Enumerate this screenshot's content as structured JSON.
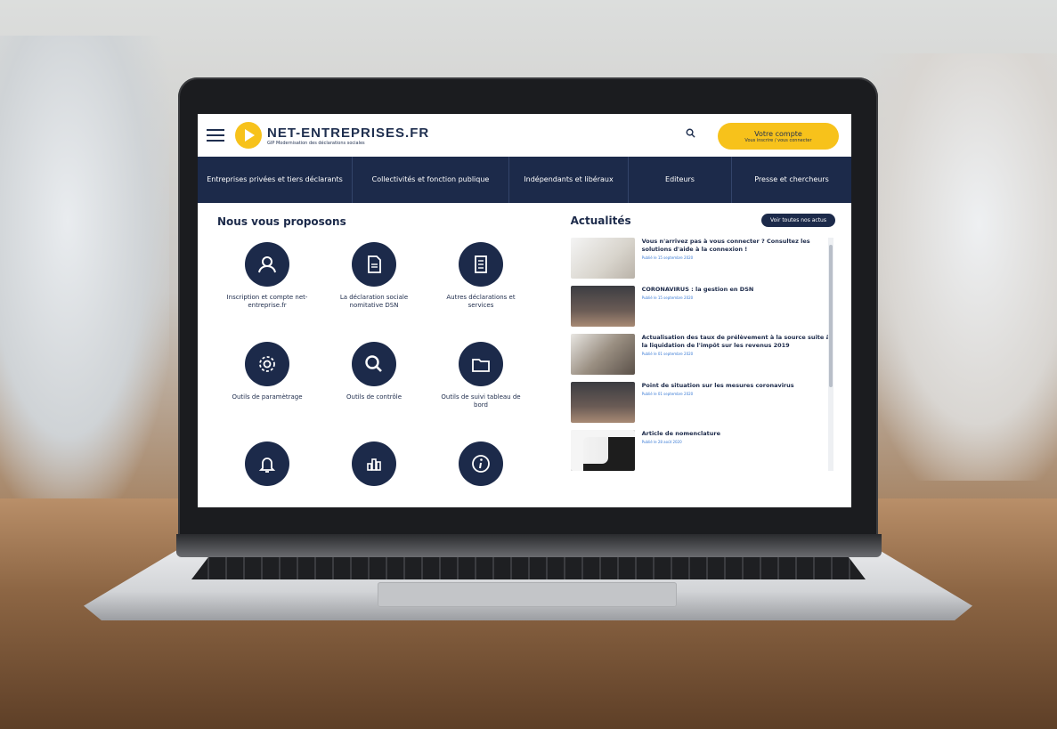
{
  "header": {
    "logo_name": "NET-ENTREPRISES.FR",
    "logo_sub": "GIP Modernisation des déclarations sociales",
    "search_icon": "search-icon",
    "account_title": "Votre compte",
    "account_sub": "Vous inscrire / vous connecter",
    "accent": "#f7c21b",
    "brand": "#1c2a4a"
  },
  "nav": [
    "Entreprises privées et tiers déclarants",
    "Collectivités et fonction publique",
    "Indépendants et libéraux",
    "Editeurs",
    "Presse et chercheurs"
  ],
  "left": {
    "title": "Nous vous proposons",
    "tiles": [
      {
        "label": "Inscription et compte net-entreprise.fr",
        "icon": "user-icon"
      },
      {
        "label": "La déclaration sociale nomitative DSN",
        "icon": "document-icon"
      },
      {
        "label": "Autres déclarations et services",
        "icon": "document-lines-icon"
      },
      {
        "label": "Outils de paramètrage",
        "icon": "gear-icon"
      },
      {
        "label": "Outils de contrôle",
        "icon": "search-icon"
      },
      {
        "label": "Outils de suivi tableau de bord",
        "icon": "folder-icon"
      },
      {
        "label": "",
        "icon": "bell-icon"
      },
      {
        "label": "",
        "icon": "bar-chart-icon"
      },
      {
        "label": "",
        "icon": "info-icon"
      }
    ]
  },
  "news": {
    "title": "Actualités",
    "see_all": "Voir toutes nos actus",
    "items": [
      {
        "title": "Vous n'arrivez pas à vous connecter ? Consultez les solutions d'aide à la connexion !",
        "date": "Publié le 15 septembre 2020"
      },
      {
        "title": "CORONAVIRUS : la gestion en DSN",
        "date": "Publié le 15 septembre 2020"
      },
      {
        "title": "Actualisation des taux de prélèvement à la source suite à la liquidation de l'impôt sur les revenus 2019",
        "date": "Publié le 01 septembre 2020"
      },
      {
        "title": "Point de situation sur les mesures coronavirus",
        "date": "Publié le 01 septembre 2020"
      },
      {
        "title": "Article de nomenclature",
        "date": "Publié le 28 août 2020"
      }
    ]
  }
}
